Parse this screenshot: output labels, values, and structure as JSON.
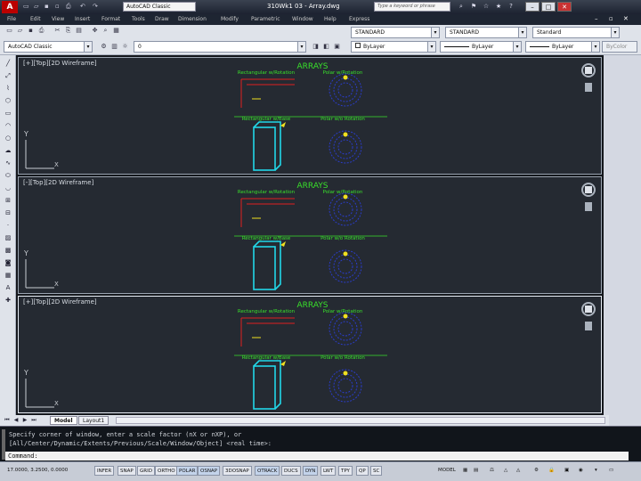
{
  "titlebar": {
    "logo": "A",
    "workspace": "AutoCAD Classic",
    "title": "310Wk1 03 - Array.dwg",
    "search_placeholder": "Type a keyword or phrase"
  },
  "menu": [
    "File",
    "Edit",
    "View",
    "Insert",
    "Format",
    "Tools",
    "Draw",
    "Dimension",
    "Modify",
    "Parametric",
    "Window",
    "Help",
    "Express"
  ],
  "toolbar": {
    "workspace_combo": "AutoCAD Classic",
    "layer_combo": "0",
    "textstyle_combo": "STANDARD",
    "dimstyle_combo": "STANDARD",
    "tablestyle_combo": "Standard",
    "color_combo": "ByLayer",
    "linetype_combo": "ByLayer",
    "lineweight_combo": "ByLayer",
    "plotstyle_combo": "ByColor"
  },
  "viewports": [
    {
      "label": "[+][Top][2D Wireframe]"
    },
    {
      "label": "[-][Top][2D Wireframe]"
    },
    {
      "label": "[+][Top][2D Wireframe]"
    }
  ],
  "drawing": {
    "heading": "ARRAYS",
    "rect_path": "Rectangular w/Rotation",
    "rect_base": "Rectangular w/Base",
    "polar_rot": "Polar w/Rotation",
    "polar_no_rot": "Polar w/o Rotation",
    "axis_y": "Y",
    "axis_x": "X"
  },
  "tabs": [
    "Model",
    "Layout1"
  ],
  "command": {
    "line1": "Specify corner of window, enter a scale factor (nX or nXP), or",
    "line2": "[All/Center/Dynamic/Extents/Previous/Scale/Window/Object] <real time>:",
    "prompt": "Command:"
  },
  "status": {
    "coords": "17.0000, 3.2500, 0.0000",
    "buttons": [
      "INFER",
      "SNAP",
      "GRID",
      "ORTHO",
      "POLAR",
      "OSNAP",
      "3DOSNAP",
      "OTRACK",
      "DUCS",
      "DYN",
      "LWT",
      "TPY",
      "QP",
      "SC"
    ],
    "model": "MODEL"
  },
  "colors": {
    "accent_green": "#39e02b",
    "cyan": "#22d8e8",
    "red": "#e02020",
    "blue": "#2a3cc8",
    "yellow": "#f0e020"
  }
}
